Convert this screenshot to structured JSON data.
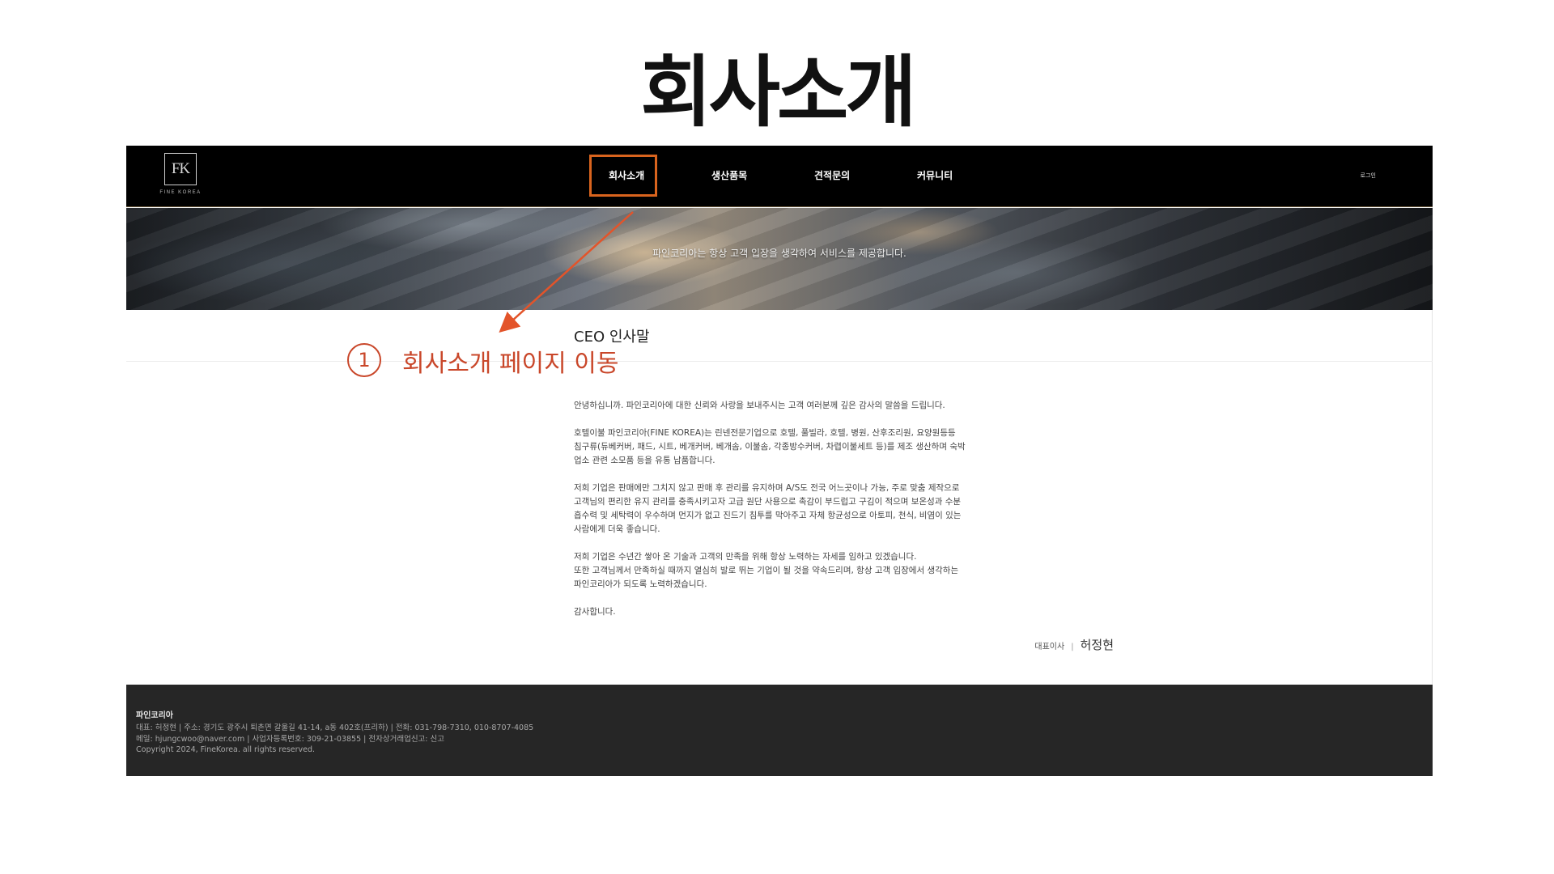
{
  "slide": {
    "title": "회사소개"
  },
  "header": {
    "logo": {
      "mark": "FK",
      "text": "FINE KOREA"
    },
    "nav": [
      {
        "label": "회사소개"
      },
      {
        "label": "생산품목"
      },
      {
        "label": "견적문의"
      },
      {
        "label": "커뮤니티"
      }
    ],
    "login_label": "로그인"
  },
  "banner": {
    "text": "파인코리아는 항상 고객 입장을 생각하여 서비스를 제공합니다."
  },
  "main": {
    "section_title": "CEO 인사말",
    "paragraphs": [
      [
        "안녕하십니까. 파인코리아에 대한 신뢰와 사랑을 보내주시는 고객 여러분께 깊은 감사의 말씀을 드립니다."
      ],
      [
        "호텔이불 파인코리아(FINE KOREA)는 린넨전문기업으로 호텔, 풀빌라, 호텔, 병원, 산후조리원, 요양원등등",
        "침구류(듀베커버, 패드, 시트, 베개커버, 베개솜, 이불솜, 각종방수커버, 차렵이불세트 등)를 제조 생산하며 숙박",
        "업소 관련 소모품 등을 유통 납품합니다."
      ],
      [
        "저희 기업은 판매에만 그치지 않고 판매 후 관리를 유지하며 A/S도 전국 어느곳이나 가능, 주로 맞춤 제작으로",
        "고객님의 편리한 유지 관리를 충족시키고자 고급 원단 사용으로 촉감이 부드럽고 구김이 적으며 보온성과 수분",
        "흡수력 및 세탁력이 우수하며 먼지가 없고 진드기 침투를 막아주고 자체 항균성으로 아토피, 천식, 비염이 있는",
        "사람에게 더욱 좋습니다."
      ],
      [
        "저희 기업은 수년간 쌓아 온 기술과 고객의 만족을 위해 항상 노력하는 자세를 임하고 있겠습니다.",
        "또한 고객님께서 만족하실 때까지 열심히 발로 뛰는 기업이 될 것을 약속드리며, 항상 고객 입장에서 생각하는",
        "파인코리아가 되도록 노력하겠습니다."
      ],
      [
        "감사합니다."
      ]
    ],
    "signature": {
      "role": "대표이사",
      "separator": "|",
      "name": "허정현"
    }
  },
  "footer": {
    "company": "파인코리아",
    "lines": [
      "대표: 허정현 | 주소: 경기도 광주시 퇴촌면 갈울길 41-14, a동 402호(프리하) | 전화: 031-798-7310, 010-8707-4085",
      "메일: hjungcwoo@naver.com | 사업자등록번호: 309-21-03855 | 전자상거래업신고: 신고",
      "Copyright 2024, FineKorea. all rights reserved."
    ]
  },
  "annotation": {
    "number": "1",
    "text": "회사소개 페이지 이동",
    "color": "#c9472a",
    "highlight_color": "#d9641e"
  }
}
